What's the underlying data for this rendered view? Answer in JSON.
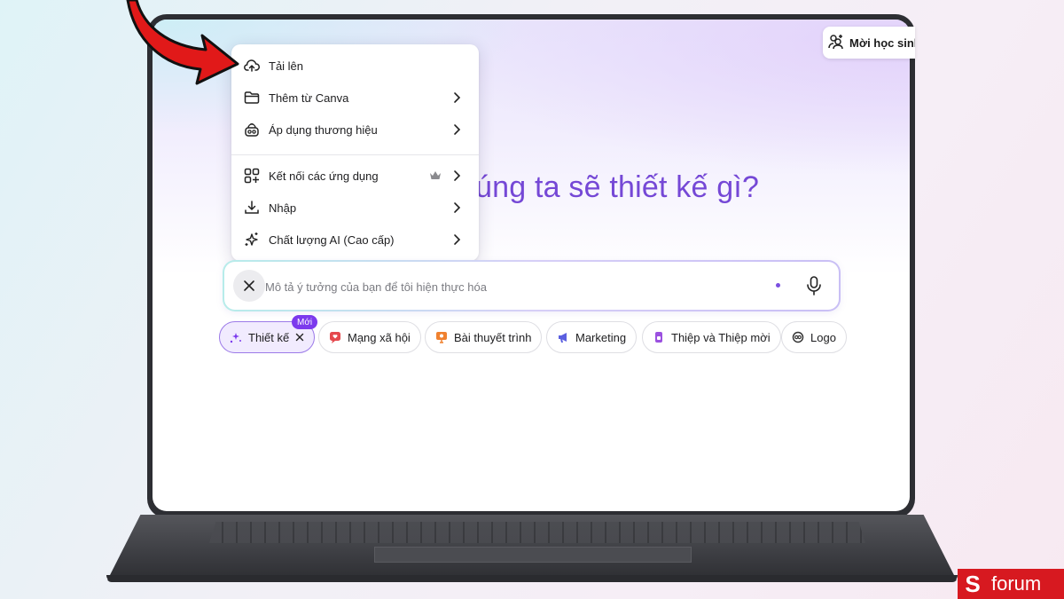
{
  "invite": {
    "label": "Mời học sinh",
    "icon": "user-plus-icon"
  },
  "headline": "úng ta sẽ thiết kế gì?",
  "menu": {
    "items": [
      {
        "label": "Tải lên",
        "icon": "cloud-upload-icon",
        "has_submenu": false
      },
      {
        "label": "Thêm từ Canva",
        "icon": "folder-icon",
        "has_submenu": true
      },
      {
        "label": "Áp dụng thương hiệu",
        "icon": "brand-kit-icon",
        "has_submenu": true
      },
      {
        "label": "Kết nối các ứng dụng",
        "icon": "apps-plus-icon",
        "has_submenu": true,
        "premium": true
      },
      {
        "label": "Nhập",
        "icon": "download-icon",
        "has_submenu": true
      },
      {
        "label": "Chất lượng AI (Cao cấp)",
        "icon": "sparkles-icon",
        "has_submenu": true
      }
    ]
  },
  "search": {
    "placeholder": "Mô tả ý tưởng của bạn để tôi hiện thực hóa",
    "value": ""
  },
  "chips": [
    {
      "label": "Thiết kế",
      "icon": "design-sparkle-icon",
      "active": true,
      "badge": "Mới",
      "icon_color": "#7c3aed"
    },
    {
      "label": "Mạng xã hội",
      "icon": "heart-chat-icon",
      "active": false,
      "icon_color": "#e5484d"
    },
    {
      "label": "Bài thuyết trình",
      "icon": "presentation-icon",
      "active": false,
      "icon_color": "#f0812f"
    },
    {
      "label": "Marketing",
      "icon": "megaphone-icon",
      "active": false,
      "icon_color": "#5b5fe0"
    },
    {
      "label": "Thiệp và Thiệp mời",
      "icon": "card-icon",
      "active": false,
      "icon_color": "#9b51e0"
    },
    {
      "label": "Logo",
      "icon": "logo-icon",
      "active": false,
      "icon_color": "#333333"
    }
  ],
  "watermark": {
    "mark": "S",
    "text": "forum"
  },
  "colors": {
    "accent": "#7c3aed",
    "headline": "#7548d6",
    "arrow": "#e11919"
  }
}
